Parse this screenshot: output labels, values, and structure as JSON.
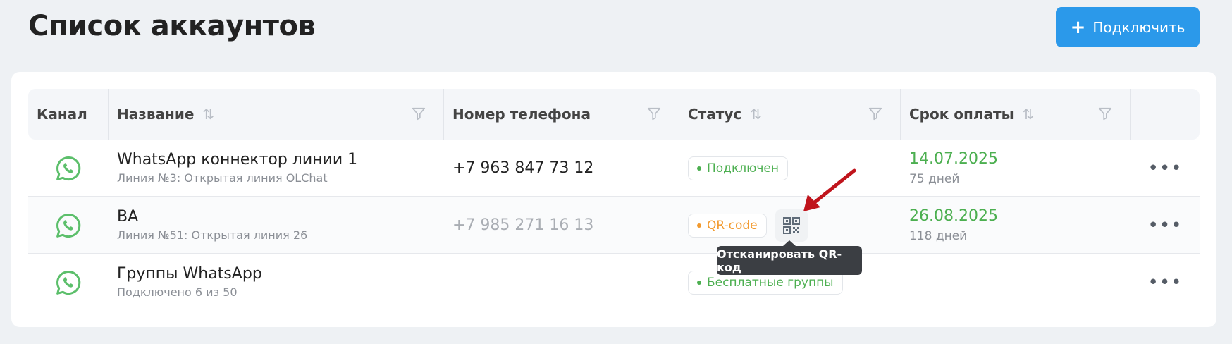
{
  "header": {
    "title": "Список аккаунтов",
    "connect_button": {
      "icon": "plus-icon",
      "label": "Подключить"
    }
  },
  "table": {
    "columns": [
      {
        "label": "Канал",
        "sortable": false,
        "filterable": false
      },
      {
        "label": "Название",
        "sortable": true,
        "filterable": true
      },
      {
        "label": "Номер телефона",
        "sortable": false,
        "filterable": true
      },
      {
        "label": "Статус",
        "sortable": true,
        "filterable": true
      },
      {
        "label": "Срок оплаты",
        "sortable": true,
        "filterable": true
      },
      {
        "label": "",
        "sortable": false,
        "filterable": false
      }
    ],
    "rows": [
      {
        "channel_icon": "whatsapp-icon",
        "name": "WhatsApp коннектор линии 1",
        "subtitle": "Линия №3: Открытая линия OLChat",
        "phone": "+7 963 847 73 12",
        "status": "Подключен",
        "payment_date": "14.07.2025",
        "payment_days": "75 дней"
      },
      {
        "channel_icon": "whatsapp-icon",
        "name": "ВА",
        "subtitle": "Линия №51: Открытая линия 26",
        "phone": "+7 985 271 16 13",
        "status": "QR-code",
        "payment_date": "26.08.2025",
        "payment_days": "118 дней"
      },
      {
        "channel_icon": "whatsapp-icon",
        "name": "Группы WhatsApp",
        "subtitle": "Подключено 6 из 50",
        "phone": "",
        "status": "Бесплатные группы",
        "payment_date": "",
        "payment_days": ""
      }
    ]
  },
  "tooltip": "Отсканировать QR-код",
  "colors": {
    "accent": "#2b99ea",
    "success": "#4caf50",
    "warning": "#f29a2e",
    "whatsapp": "#5cbf6b",
    "annotation_arrow": "#c0141c"
  }
}
